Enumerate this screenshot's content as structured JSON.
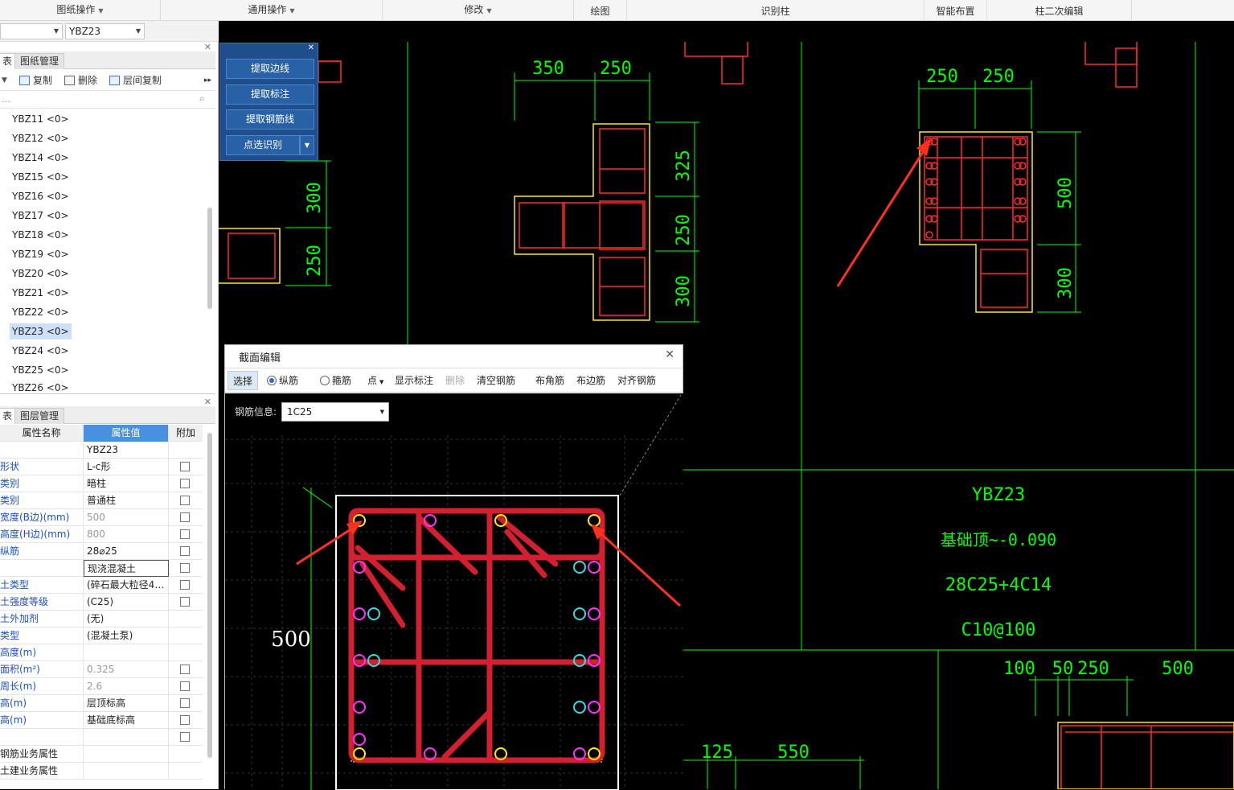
{
  "ribbon": {
    "groups": [
      {
        "label": "图纸操作",
        "dropdown": true
      },
      {
        "label": "通用操作",
        "dropdown": true
      },
      {
        "label": "修改",
        "dropdown": true
      },
      {
        "label": "绘图",
        "dropdown": false
      },
      {
        "label": "识别柱",
        "dropdown": false
      },
      {
        "label": "智能布置",
        "dropdown": false
      },
      {
        "label": "柱二次编辑",
        "dropdown": false
      }
    ]
  },
  "combos": {
    "floor": "",
    "component": "YBZ23"
  },
  "left_panel": {
    "tabs_top": [
      "表",
      "图纸管理"
    ],
    "toolbar": {
      "copy": "复制",
      "delete": "删除",
      "floor_copy": "层间复制"
    },
    "search_placeholder": "…",
    "tree_items": [
      "YBZ11 <0>",
      "YBZ12 <0>",
      "YBZ14 <0>",
      "YBZ15 <0>",
      "YBZ16 <0>",
      "YBZ17 <0>",
      "YBZ18 <0>",
      "YBZ19 <0>",
      "YBZ20 <0>",
      "YBZ21 <0>",
      "YBZ22 <0>",
      "YBZ23 <0>",
      "YBZ24 <0>",
      "YBZ25 <0>",
      "YBZ26 <0>"
    ],
    "selected_item": "YBZ23 <0>",
    "tabs_bottom": [
      "表",
      "图层管理"
    ],
    "prop_headers": {
      "name": "属性名称",
      "value": "属性值",
      "extra": "附加"
    },
    "props": [
      {
        "name": "",
        "value": "YBZ23",
        "check": false,
        "gray": false
      },
      {
        "name": "形状",
        "value": "L-c形",
        "check": true,
        "gray": false
      },
      {
        "name": "类别",
        "value": "暗柱",
        "check": true,
        "gray": false
      },
      {
        "name": "类别",
        "value": "普通柱",
        "check": true,
        "gray": false
      },
      {
        "name": "宽度(B边)(mm)",
        "value": "500",
        "check": true,
        "gray": true
      },
      {
        "name": "高度(H边)(mm)",
        "value": "800",
        "check": true,
        "gray": true
      },
      {
        "name": "纵筋",
        "value": "28⌀25",
        "check": true,
        "gray": false
      },
      {
        "name": "",
        "value": "现浇混凝土",
        "check": true,
        "gray": false
      },
      {
        "name": "土类型",
        "value": "(碎石最大粒径4…",
        "check": true,
        "gray": false
      },
      {
        "name": "土强度等级",
        "value": "(C25)",
        "check": true,
        "gray": false
      },
      {
        "name": "土外加剂",
        "value": "(无)",
        "check": false,
        "gray": false
      },
      {
        "name": "类型",
        "value": "(混凝土泵)",
        "check": false,
        "gray": false
      },
      {
        "name": "高度(m)",
        "value": "",
        "check": false,
        "gray": false
      },
      {
        "name": "面积(m²)",
        "value": "0.325",
        "check": true,
        "gray": true
      },
      {
        "name": "周长(m)",
        "value": "2.6",
        "check": true,
        "gray": true
      },
      {
        "name": "高(m)",
        "value": "层顶标高",
        "check": true,
        "gray": false
      },
      {
        "name": "高(m)",
        "value": "基础底标高",
        "check": true,
        "gray": false
      },
      {
        "name": "",
        "value": "",
        "check": true,
        "gray": false
      },
      {
        "name": "钢筋业务属性",
        "value": "",
        "check": false,
        "gray": false
      },
      {
        "name": "土建业务属性",
        "value": "",
        "check": false,
        "gray": false
      }
    ]
  },
  "float_panel": {
    "buttons": [
      "提取边线",
      "提取标注",
      "提取钢筋线",
      "点选识别"
    ]
  },
  "dialog": {
    "title": "截面编辑",
    "toolbar": {
      "select": "选择",
      "longitudinal": "纵筋",
      "stirrup": "箍筋",
      "point": "点",
      "show_label": "显示标注",
      "delete": "删除",
      "clear": "清空钢筋",
      "corner": "布角筋",
      "edge": "布边筋",
      "align": "对齐钢筋"
    },
    "rebar_info_label": "钢筋信息:",
    "rebar_info_value": "1C25",
    "dim_500": "500"
  },
  "cad": {
    "dims_a": [
      "350",
      "250",
      "325",
      "250",
      "300"
    ],
    "dims_b": [
      "250",
      "250",
      "500",
      "300"
    ],
    "dims_left": [
      "300",
      "250"
    ],
    "table": [
      "YBZ23",
      "基础顶~-0.090",
      "28C25+4C14",
      "C10@100"
    ],
    "dims_c": [
      "100",
      "50",
      "250",
      "500"
    ],
    "dims_d": [
      "125",
      "550"
    ]
  },
  "colors": {
    "cad_green": "#00ff00",
    "cad_red": "#ff2a2a",
    "cad_yellow": "#ffee00",
    "rebar": "#d32030",
    "arrow": "#ff3020",
    "magenta": "#ff33ff",
    "cyan": "#33dddd"
  }
}
